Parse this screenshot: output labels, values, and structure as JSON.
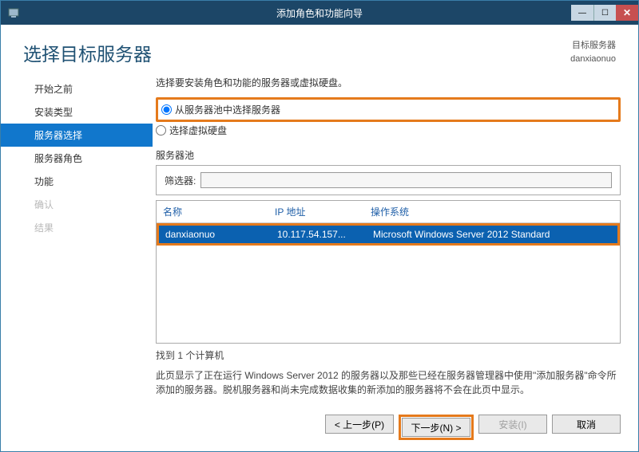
{
  "window": {
    "title": "添加角色和功能向导"
  },
  "header": {
    "page_title": "选择目标服务器",
    "right_label": "目标服务器",
    "right_value": "danxiaonuo"
  },
  "sidebar": {
    "items": [
      {
        "label": "开始之前"
      },
      {
        "label": "安装类型"
      },
      {
        "label": "服务器选择"
      },
      {
        "label": "服务器角色"
      },
      {
        "label": "功能"
      },
      {
        "label": "确认"
      },
      {
        "label": "结果"
      }
    ]
  },
  "content": {
    "prompt": "选择要安装角色和功能的服务器或虚拟硬盘。",
    "radio_pool": "从服务器池中选择服务器",
    "radio_vhd": "选择虚拟硬盘",
    "pool_label": "服务器池",
    "filter_label": "筛选器:",
    "filter_value": "",
    "columns": {
      "name": "名称",
      "ip": "IP 地址",
      "os": "操作系统"
    },
    "rows": [
      {
        "name": "danxiaonuo",
        "ip": "10.117.54.157...",
        "os": "Microsoft Windows Server 2012 Standard"
      }
    ],
    "found": "找到 1 个计算机",
    "description": "此页显示了正在运行 Windows Server 2012 的服务器以及那些已经在服务器管理器中使用\"添加服务器\"命令所添加的服务器。脱机服务器和尚未完成数据收集的新添加的服务器将不会在此页中显示。"
  },
  "footer": {
    "prev": "< 上一步(P)",
    "next": "下一步(N) >",
    "install": "安装(I)",
    "cancel": "取消"
  }
}
